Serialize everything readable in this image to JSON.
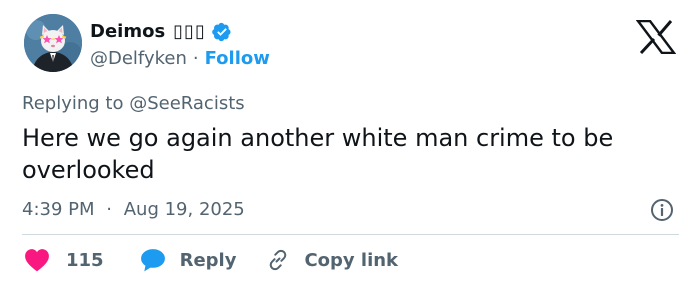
{
  "author": {
    "name": "Deimos",
    "name_suffix": "▯▯▯",
    "handle": "@Delfyken",
    "separator": "·",
    "follow_label": "Follow",
    "avatar_icon": "cat-avatar-icon",
    "verified_icon": "verified-badge-icon",
    "verified_color": "#1d9bf0"
  },
  "platform": {
    "logo_icon": "x-logo-icon"
  },
  "reply_context": {
    "prefix": "Replying to",
    "mention": "@SeeRacists"
  },
  "tweet": {
    "text": "Here we go again another white man crime to be overlooked",
    "time": "4:39 PM",
    "separator": "·",
    "date": "Aug 19, 2025"
  },
  "actions": {
    "like_count": "115",
    "like_color": "#f91880",
    "reply_label": "Reply",
    "reply_color": "#1d9bf0",
    "copy_label": "Copy link"
  },
  "colors": {
    "text": "#0f1419",
    "muted": "#536471",
    "accent": "#1d9bf0",
    "divider": "#cfd9de"
  }
}
